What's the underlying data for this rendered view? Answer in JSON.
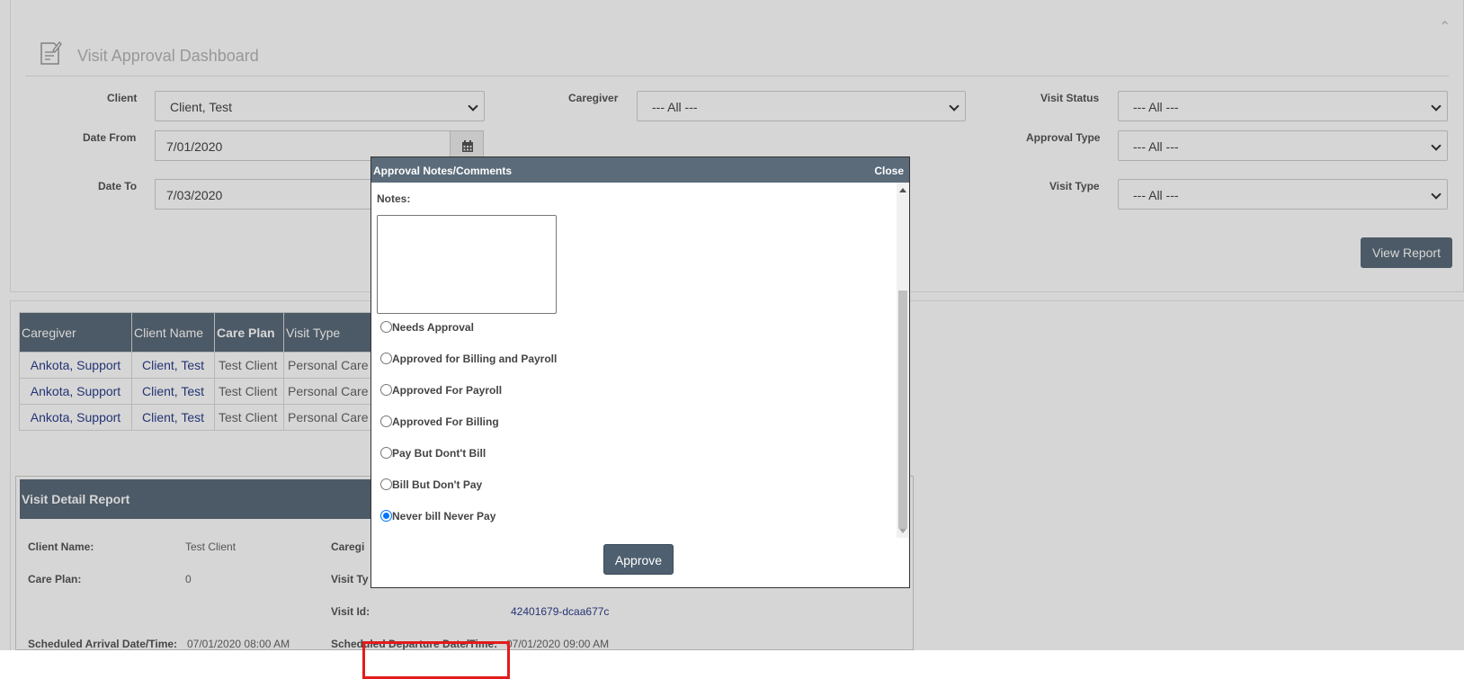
{
  "dashboard": {
    "title": "Visit Approval Dashboard",
    "filters": {
      "client_label": "Client",
      "client_value": "Client, Test",
      "caregiver_label": "Caregiver",
      "caregiver_value": "--- All ---",
      "visit_status_label": "Visit Status",
      "visit_status_value": "--- All ---",
      "date_from_label": "Date From",
      "date_from_value": "7/01/2020",
      "approval_type_label": "Approval Type",
      "approval_type_value": "--- All ---",
      "date_to_label": "Date To",
      "date_to_value": "7/03/2020",
      "visit_type_label": "Visit Type",
      "visit_type_value": "--- All ---"
    },
    "view_report_label": "View Report"
  },
  "results": {
    "headers": [
      "Caregiver",
      "Client Name",
      "Care Plan",
      "Visit Type"
    ],
    "rows": [
      [
        "Ankota, Support",
        "Client, Test",
        "Test Client",
        "Personal Care"
      ],
      [
        "Ankota, Support",
        "Client, Test",
        "Test Client",
        "Personal Care"
      ],
      [
        "Ankota, Support",
        "Client, Test",
        "Test Client",
        "Personal Care"
      ]
    ]
  },
  "detail": {
    "header": "Visit Detail Report",
    "client_name_label": "Client Name:",
    "client_name_value": "Test Client",
    "caregiver_label": "Caregi",
    "care_plan_label": "Care Plan:",
    "care_plan_value": "0",
    "visit_type_label": "Visit Ty",
    "visit_id_label": "Visit Id:",
    "visit_id_value": "42401679-dcaa677c",
    "sched_arrival_label": "Scheduled Arrival Date/Time:",
    "sched_arrival_value": "07/01/2020 08:00 AM",
    "sched_departure_label": "Scheduled Departure Date/Time:",
    "sched_departure_value": "07/01/2020 09:00 AM"
  },
  "modal": {
    "title": "Approval Notes/Comments",
    "close_label": "Close",
    "notes_label": "Notes:",
    "notes_value": "",
    "options": [
      {
        "label": "Needs Approval",
        "checked": false
      },
      {
        "label": "Approved for Billing and Payroll",
        "checked": false
      },
      {
        "label": "Approved For Payroll",
        "checked": false
      },
      {
        "label": "Approved For Billing",
        "checked": false
      },
      {
        "label": "Pay But Dont't Bill",
        "checked": false
      },
      {
        "label": "Bill But Don't Pay",
        "checked": false
      },
      {
        "label": "Never bill Never Pay",
        "checked": true
      }
    ],
    "approve_label": "Approve"
  },
  "colors": {
    "header_bg": "#5b6b7a",
    "highlight": "#e31b1b",
    "link": "#2c3e8a"
  }
}
